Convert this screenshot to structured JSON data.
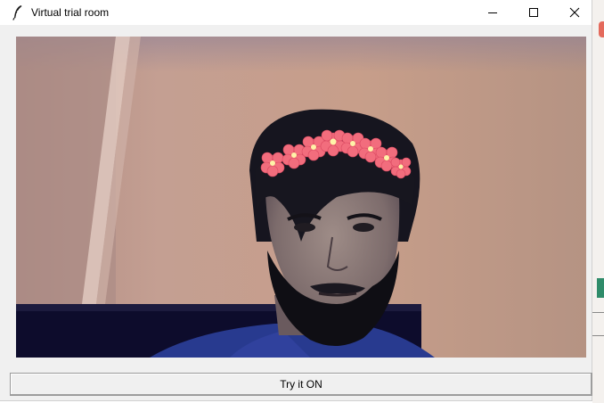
{
  "window": {
    "title": "Virtual trial room",
    "controls": [
      "minimize-icon",
      "maximize-icon",
      "close-icon"
    ]
  },
  "main": {
    "camera_feed": {
      "overlay": "flower-crown"
    },
    "try_button_label": "Try it ON"
  },
  "colors": {
    "titlebar": "#ffffff",
    "window_bg": "#f0f0f0",
    "wall": "#c59c8a",
    "flower": "#f26d7d"
  }
}
